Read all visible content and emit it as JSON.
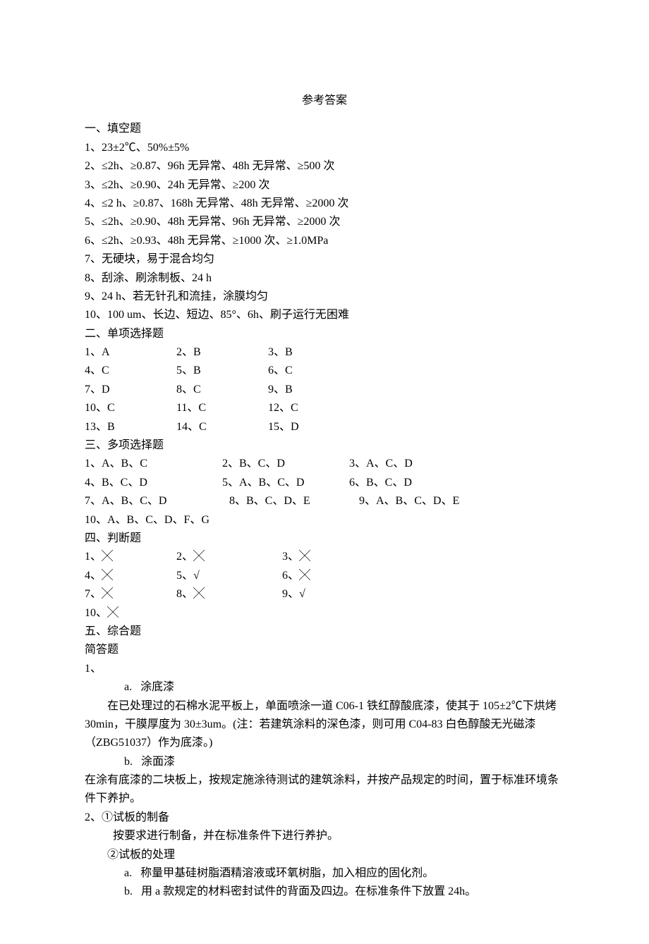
{
  "title": "参考答案",
  "section1": {
    "heading": "一、填空题",
    "items": [
      "1、23±2℃、50%±5%",
      "2、≤2h、≥0.87、96h 无异常、48h 无异常、≥500 次",
      "3、≤2h、≥0.90、24h 无异常、≥200 次",
      "4、≤2 h、≥0.87、168h 无异常、48h 无异常、≥2000 次",
      "5、≤2h、≥0.90、48h 无异常、96h 无异常、≥2000 次",
      "6、≤2h、≥0.93、48h 无异常、≥1000 次、≥1.0MPa",
      "7、无硬块，易于混合均匀",
      "8、刮涂、刷涂制板、24 h",
      "9、24 h、若无针孔和流挂，涂膜均匀",
      "10、100 um、长边、短边、85°、6h、刷子运行无困难"
    ]
  },
  "section2": {
    "heading": "二、单项选择题",
    "rows": [
      [
        "1、A",
        "2、B",
        "3、B"
      ],
      [
        "4、C",
        "5、B",
        "6、C"
      ],
      [
        "7、D",
        "8、C",
        "9、B"
      ],
      [
        "10、C",
        "11、C",
        "12、C"
      ],
      [
        "13、B",
        "14、C",
        "15、D"
      ]
    ]
  },
  "section3": {
    "heading": "三、多项选择题",
    "rows": [
      [
        "1、A、B、C",
        "2、B、C、D",
        "3、A、C、D"
      ],
      [
        "4、B、C、D",
        "5、A、B、C、D",
        "6、B、C、D"
      ],
      [
        "7、A、B、C、D",
        "8、B、C、D、E",
        " 9、A、B、C、D、E"
      ],
      [
        "10、A、B、C、D、F、G",
        "",
        ""
      ]
    ]
  },
  "section4": {
    "heading": "四、判断题",
    "rows": [
      [
        "1、╳",
        "2、╳",
        "3、╳"
      ],
      [
        "4、╳",
        "5、√",
        "6、╳"
      ],
      [
        "7、╳",
        "8、╳",
        "9、√"
      ],
      [
        "10、╳",
        "",
        ""
      ]
    ]
  },
  "section5": {
    "heading": "五、综合题",
    "subheading": "简答题",
    "q1_label": "1、",
    "q1_a_label": "a.   涂底漆",
    "q1_a_text": "在已处理过的石棉水泥平板上，单面喷涂一道 C06-1 铁红醇酸底漆，使其于 105±2℃下烘烤 30min，干膜厚度为 30±3um。(注：若建筑涂料的深色漆，则可用 C04-83 白色醇酸无光磁漆（ZBG51037）作为底漆。)",
    "q1_b_label": "b.   涂面漆",
    "q1_b_text": "在涂有底漆的二块板上，按规定施涂待测试的建筑涂料，并按产品规定的时间，置于标准环境条件下养护。",
    "q2_line1": "2、①试板的制备",
    "q2_line2": "按要求进行制备，并在标准条件下进行养护。",
    "q2_line3": "②试板的处理",
    "q2_a": "a.   称量甲基硅树脂酒精溶液或环氧树脂，加入相应的固化剂。",
    "q2_b": "b.   用 a 款规定的材料密封试件的背面及四边。在标准条件下放置 24h。"
  }
}
